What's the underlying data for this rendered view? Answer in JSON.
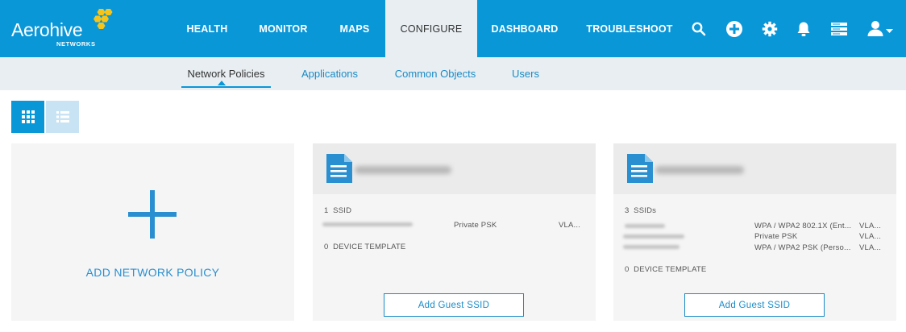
{
  "brand": {
    "name": "Aerohive",
    "sub": "NETWORKS",
    "primary_color": "#0a97d8",
    "hex_color": "#f7c41a"
  },
  "nav": {
    "health": "HEALTH",
    "monitor": "MONITOR",
    "maps": "MAPS",
    "configure": "CONFIGURE",
    "dashboard": "DASHBOARD",
    "troubleshoot": "TROUBLESHOOT",
    "active": "CONFIGURE"
  },
  "top_icons": [
    "search-icon",
    "add-circle-icon",
    "gear-icon",
    "bell-icon",
    "server-icon",
    "user-icon"
  ],
  "subnav": {
    "network_policies": "Network Policies",
    "applications": "Applications",
    "common_objects": "Common Objects",
    "users": "Users",
    "active": "Network Policies"
  },
  "view_toggle": {
    "selected": "grid"
  },
  "add_card": {
    "label": "ADD NETWORK POLICY"
  },
  "policies": [
    {
      "ssid_count": "1",
      "ssid_label": "SSID",
      "ssids": [
        {
          "auth": "Private PSK",
          "vlan": "VLA..."
        }
      ],
      "device_template_count": "0",
      "device_template_label": "DEVICE TEMPLATE",
      "button": "Add Guest SSID"
    },
    {
      "ssid_count": "3",
      "ssid_label": "SSIDs",
      "ssids": [
        {
          "auth": "WPA / WPA2 802.1X (Ent...",
          "vlan": "VLA..."
        },
        {
          "auth": "Private PSK",
          "vlan": "VLA..."
        },
        {
          "auth": "WPA / WPA2 PSK (Perso...",
          "vlan": "VLA..."
        }
      ],
      "device_template_count": "0",
      "device_template_label": "DEVICE TEMPLATE",
      "button": "Add Guest SSID"
    }
  ]
}
